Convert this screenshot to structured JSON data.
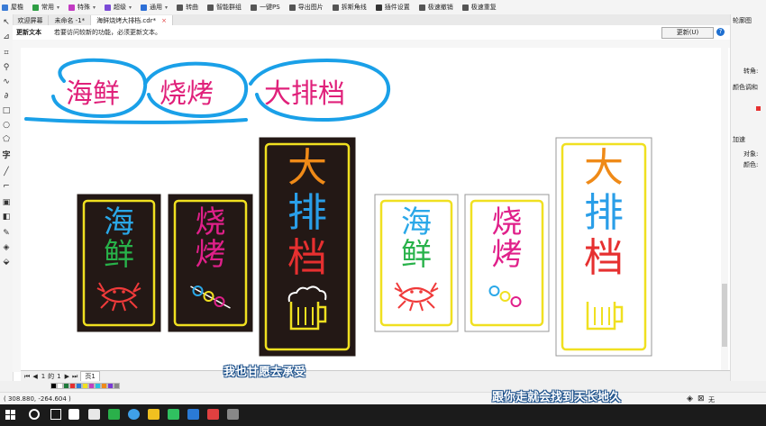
{
  "menubar": {
    "items": [
      {
        "label": "屋檐",
        "color": "#3a7bd5",
        "arrow": false
      },
      {
        "label": "常用",
        "color": "#2e9e44",
        "arrow": true
      },
      {
        "label": "特殊",
        "color": "#c23ac2",
        "arrow": true
      },
      {
        "label": "超级",
        "color": "#7a4ad6",
        "arrow": true
      },
      {
        "label": "通用",
        "color": "#2c6fd6",
        "arrow": true
      },
      {
        "label": "转曲",
        "color": "#555555",
        "arrow": false
      },
      {
        "label": "智能群组",
        "color": "#555555",
        "arrow": false
      },
      {
        "label": "一键PS",
        "color": "#555555",
        "arrow": false
      },
      {
        "label": "导出图片",
        "color": "#555555",
        "arrow": false
      },
      {
        "label": "拆斯角线",
        "color": "#555555",
        "arrow": false
      },
      {
        "label": "插件设置",
        "color": "#333333",
        "arrow": false
      },
      {
        "label": "极速撤销",
        "color": "#555555",
        "arrow": false
      },
      {
        "label": "极速重复",
        "color": "#555555",
        "arrow": false
      }
    ]
  },
  "tabs": [
    {
      "label": "欢迎屏幕",
      "closable": false,
      "active": false
    },
    {
      "label": "未命名 -1*",
      "closable": false,
      "active": false
    },
    {
      "label": "海鲜烧烤大排档.cdr*",
      "closable": true,
      "active": true
    }
  ],
  "notice": {
    "title": "更新文本",
    "message": "若要访问较新的功能，必须更新文本。",
    "button": "更新(U)",
    "help": "?",
    "close": "✕"
  },
  "right_panel": {
    "title": "轮廓图",
    "labels": [
      "转角:",
      "颜色调和",
      "加速",
      "对象:",
      "颜色:"
    ]
  },
  "heading": {
    "words": [
      "海鲜",
      "烧烤",
      "大排档"
    ]
  },
  "signs": [
    {
      "theme": "dark",
      "lines": [
        "海",
        "鲜"
      ],
      "line_colors": [
        "#2aa8e8",
        "#28b24a"
      ],
      "icon": "crab-icon"
    },
    {
      "theme": "dark",
      "lines": [
        "烧",
        "烤"
      ],
      "line_colors": [
        "#e0208a",
        "#e0208a"
      ],
      "icon": "skewer-icon"
    },
    {
      "theme": "dark",
      "lines": [
        "大",
        "排",
        "档"
      ],
      "line_colors": [
        "#ef8a18",
        "#2a9ee8",
        "#e63030"
      ],
      "icon": "beer-icon"
    },
    {
      "theme": "light",
      "lines": [
        "海",
        "鲜"
      ],
      "line_colors": [
        "#2aa8e8",
        "#28b24a"
      ],
      "icon": "crab-icon"
    },
    {
      "theme": "light",
      "lines": [
        "烧",
        "烤"
      ],
      "line_colors": [
        "#e0208a",
        "#e0208a"
      ],
      "icon": "skewer-icon"
    },
    {
      "theme": "light",
      "lines": [
        "大",
        "排",
        "档"
      ],
      "line_colors": [
        "#ef8a18",
        "#2a9ee8",
        "#e63030"
      ],
      "icon": "beer-icon"
    }
  ],
  "pagebar": {
    "page_index": "1",
    "of": "的",
    "total": "1",
    "page_tab": "页1"
  },
  "status": {
    "coords": "( 308.880, -264.604 )",
    "fill_none": "无"
  },
  "palette": [
    "#000000",
    "#ffffff",
    "#1e7a3a",
    "#e63030",
    "#2a7ad6",
    "#f0e020",
    "#c040c0",
    "#2ac0e0",
    "#ef8a18",
    "#7a3ad6",
    "#888888"
  ],
  "subtitles": {
    "line1": "我也甘愿去承受",
    "line2": "跟你走就会找到天长地久"
  }
}
